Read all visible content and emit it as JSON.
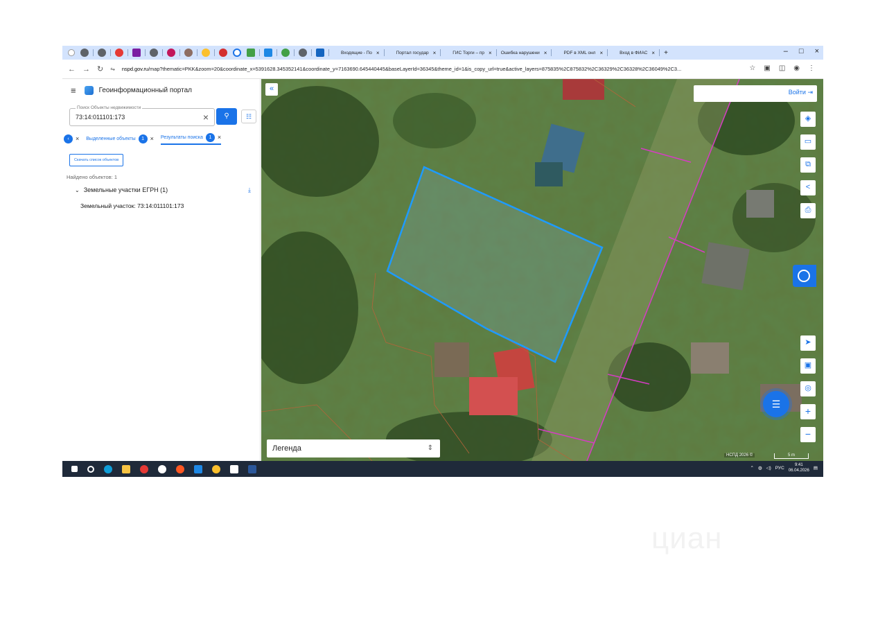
{
  "browser": {
    "tabs": [
      {
        "label": "Входящие - По",
        "icon_color": "#1a73e8"
      },
      {
        "label": "Портал государ",
        "icon_color": "#d32f2f"
      },
      {
        "label": "ГИС Торги – пр",
        "icon_color": "#1565c0"
      },
      {
        "label": "Ошибка нарушени",
        "icon_color": "#777777"
      },
      {
        "label": "PDF в XML онл",
        "icon_color": "#f9a825"
      },
      {
        "label": "Вход в ФИАС",
        "icon_color": "#555555"
      }
    ],
    "new_tab_label": "+",
    "url_host": "nspd.gov.ru",
    "url_rest": "/map?thematic=PKK&zoom=20&coordinate_x=5391628.345352141&coordinate_y=7163690.645440445&baseLayerId=36345&theme_id=1&is_copy_url=true&active_layers=875835%2C875832%2C36329%2C36328%2C36049%2C3..."
  },
  "sidebar": {
    "title": "Геоинформационный портал",
    "search": {
      "label": "Поиск Объекты недвижимости",
      "value": "73:14:011101:173"
    },
    "tabs": {
      "selected_label": "Выделенные объекты",
      "selected_count": "1",
      "results_label": "Результаты поиска",
      "results_count": "1"
    },
    "download_list_label": "Скачать список объектов",
    "found_text": "Найдено объектов: 1",
    "group_label": "Земельные участки ЕГРН (1)",
    "result_item": "Земельный участок: 73:14:011101:173"
  },
  "map": {
    "login_label": "Войти",
    "legend_label": "Легенда",
    "attribution": "НСПД 2026 ©",
    "scale_label": "5 m",
    "zoom_in": "+",
    "zoom_out": "−",
    "parcel_color": "#1e9bff",
    "boundary_color": "#d63cc4"
  },
  "taskbar": {
    "language": "РУС",
    "time": "9:41",
    "date": "06.04.2026"
  },
  "watermark": "циан"
}
